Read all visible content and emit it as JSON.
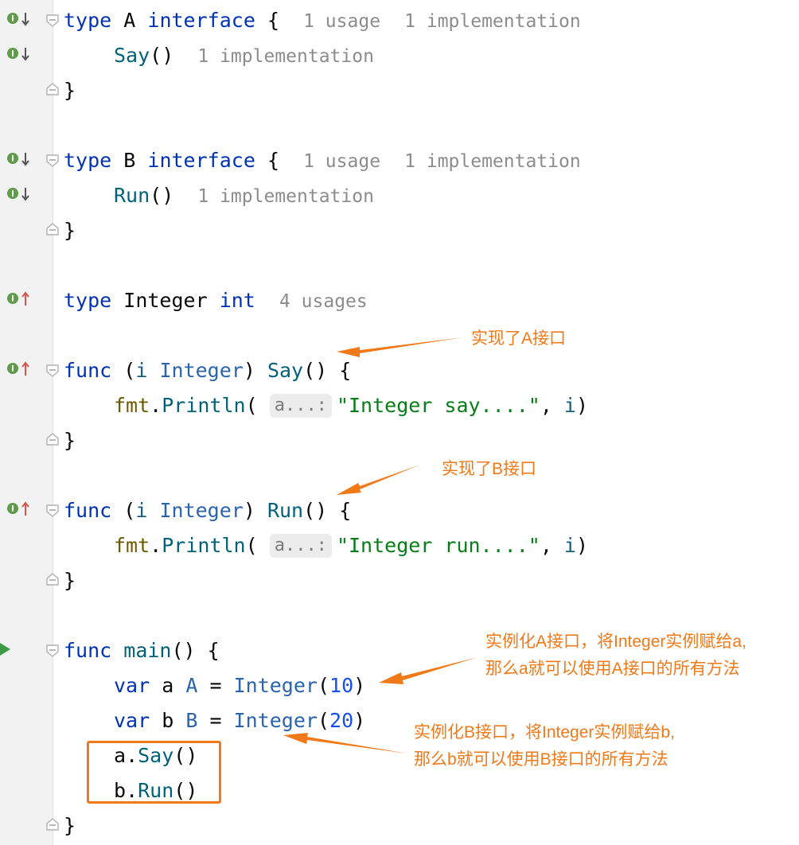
{
  "editor": {
    "lines": {
      "l1": {
        "type": "type",
        "name": "A",
        "iface": "interface",
        "brace": "{",
        "hint_usage": "1 usage",
        "hint_impl": "1 implementation"
      },
      "l2": {
        "method": "Say",
        "parens": "()",
        "hint_impl": "1 implementation"
      },
      "l3": {
        "brace": "}"
      },
      "l5": {
        "type": "type",
        "name": "B",
        "iface": "interface",
        "brace": "{",
        "hint_usage": "1 usage",
        "hint_impl": "1 implementation"
      },
      "l6": {
        "method": "Run",
        "parens": "()",
        "hint_impl": "1 implementation"
      },
      "l7": {
        "brace": "}"
      },
      "l9": {
        "type": "type",
        "name": "Integer",
        "base": "int",
        "hint_usage": "4 usages"
      },
      "l11": {
        "func": "func",
        "open": "(",
        "recv": "i",
        "recv_type": "Integer",
        "close": ")",
        "method": "Say",
        "parens": "()",
        "brace": "{"
      },
      "l12": {
        "pkg": "fmt",
        "dot": ".",
        "call": "Println",
        "open": "(",
        "param_hint": "a...:",
        "str": "\"Integer say....\"",
        "comma": ", ",
        "arg": "i",
        "close": ")"
      },
      "l13": {
        "brace": "}"
      },
      "l15": {
        "func": "func",
        "open": "(",
        "recv": "i",
        "recv_type": "Integer",
        "close": ")",
        "method": "Run",
        "parens": "()",
        "brace": "{"
      },
      "l16": {
        "pkg": "fmt",
        "dot": ".",
        "call": "Println",
        "open": "(",
        "param_hint": "a...:",
        "str": "\"Integer run....\"",
        "comma": ", ",
        "arg": "i",
        "close": ")"
      },
      "l17": {
        "brace": "}"
      },
      "l19": {
        "func": "func",
        "name": "main",
        "parens": "()",
        "brace": "{"
      },
      "l20": {
        "var": "var",
        "name": "a",
        "type": "A",
        "eq": "=",
        "conv": "Integer",
        "open": "(",
        "num": "10",
        "close": ")"
      },
      "l21": {
        "var": "var",
        "name": "b",
        "type": "B",
        "eq": "=",
        "conv": "Integer",
        "open": "(",
        "num": "20",
        "close": ")"
      },
      "l22": {
        "recv": "a",
        "dot": ".",
        "method": "Say",
        "parens": "()"
      },
      "l23": {
        "recv": "b",
        "dot": ".",
        "method": "Run",
        "parens": "()"
      },
      "l24": {
        "brace": "}"
      }
    },
    "icons": {
      "implemented": "implemented-down-icon",
      "implementing": "implementing-up-icon",
      "run": "run-triangle-icon",
      "fold": "fold-marker-icon"
    },
    "colors": {
      "keyword": "#0033b3",
      "string": "#067d17",
      "number": "#1750eb",
      "annotation": "#f27918",
      "run": "#3c9a47"
    }
  },
  "annotations": {
    "a": "实现了A接口",
    "b": "实现了B接口",
    "main_a_1": "实例化A接口，将Integer实例赋给a,",
    "main_a_2": "那么a就可以使用A接口的所有方法",
    "main_b_1": "实例化B接口，将Integer实例赋给b,",
    "main_b_2": "那么b就可以使用B接口的所有方法"
  }
}
